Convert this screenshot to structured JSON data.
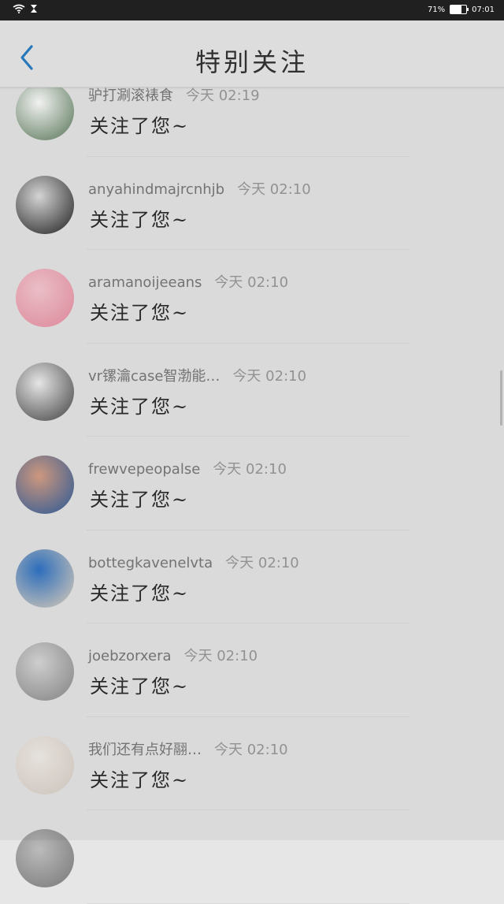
{
  "status_bar": {
    "battery_percent": "71%",
    "battery_level": 0.71,
    "time": "07:01",
    "icons": [
      "wifi-icon",
      "hourglass-icon",
      "battery-icon"
    ]
  },
  "header": {
    "title": "特别关注",
    "back_icon": "chevron-left-icon",
    "accent_color": "#2a7fc4"
  },
  "items": [
    {
      "name": "驴打涮滚裱食",
      "time": "今天 02:19",
      "message": "关注了您~",
      "avatar_colors": [
        "#ffffff",
        "#5a7a5a"
      ]
    },
    {
      "name": "anyahindmajrcnhjb",
      "time": "今天 02:10",
      "message": "关注了您~",
      "avatar_colors": [
        "#e0e0e0",
        "#202020"
      ]
    },
    {
      "name": "aramanoijeeans",
      "time": "今天 02:10",
      "message": "关注了您~",
      "avatar_colors": [
        "#f7c9d2",
        "#e98fa2"
      ]
    },
    {
      "name": "vr镙瀹case智渤能…",
      "time": "今天 02:10",
      "message": "关注了您~",
      "avatar_colors": [
        "#f2f2f2",
        "#444444"
      ]
    },
    {
      "name": "frewvepeopalse",
      "time": "今天 02:10",
      "message": "关注了您~",
      "avatar_colors": [
        "#d9a085",
        "#2b5d9e"
      ]
    },
    {
      "name": "bottegkavenelvta",
      "time": "今天 02:10",
      "message": "关注了您~",
      "avatar_colors": [
        "#2f74c7",
        "#e6d7c1"
      ]
    },
    {
      "name": "joebzorxera",
      "time": "今天 02:10",
      "message": "关注了您~",
      "avatar_colors": [
        "#d9d9d9",
        "#8a8a8a"
      ]
    },
    {
      "name": "我们还有点好翮…",
      "time": "今天 02:10",
      "message": "关注了您~",
      "avatar_colors": [
        "#f2ede8",
        "#d8cfc6"
      ]
    },
    {
      "name": "",
      "time": "",
      "message": "",
      "avatar_colors": [
        "#bbbbbb",
        "#777777"
      ]
    }
  ]
}
